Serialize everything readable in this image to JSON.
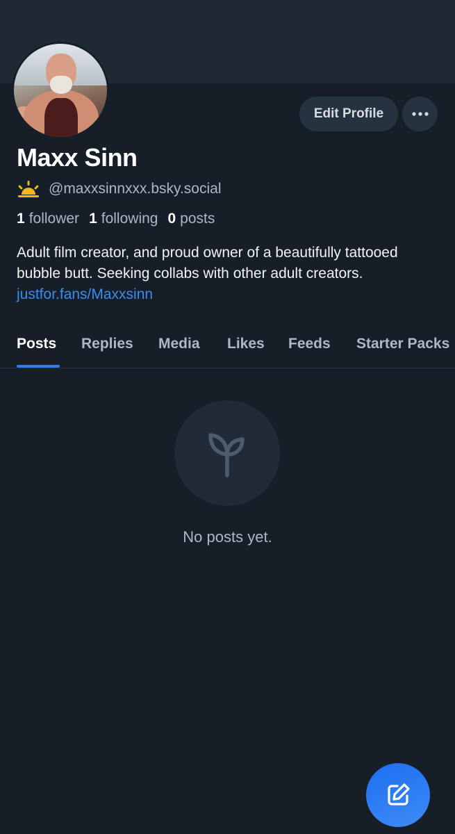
{
  "profile": {
    "display_name": "Maxx Sinn",
    "handle": "@maxxsinnxxx.bsky.social",
    "handle_emoji": "sunrise-emoji",
    "stats": {
      "followers_count": "1",
      "followers_label": "follower",
      "following_count": "1",
      "following_label": "following",
      "posts_count": "0",
      "posts_label": "posts"
    },
    "bio_text": "Adult film creator, and proud owner of a beautifully tattooed bubble butt. Seeking collabs with other adult creators. ",
    "bio_link": "justfor.fans/Maxxsinn"
  },
  "actions": {
    "edit_profile_label": "Edit Profile",
    "more_icon": "ellipsis-icon"
  },
  "tabs": [
    {
      "label": "Posts",
      "active": true
    },
    {
      "label": "Replies",
      "active": false
    },
    {
      "label": "Media",
      "active": false
    },
    {
      "label": "Likes",
      "active": false
    },
    {
      "label": "Feeds",
      "active": false
    },
    {
      "label": "Starter Packs",
      "active": false
    }
  ],
  "empty_state": {
    "icon": "sprout-icon",
    "message": "No posts yet."
  },
  "fab": {
    "icon": "compose-icon"
  },
  "colors": {
    "background": "#161e27",
    "banner": "#1f2935",
    "accent": "#2f7cf6",
    "link": "#3a8cf3",
    "muted_text": "#aeb8c4",
    "button_bg": "#273240"
  }
}
